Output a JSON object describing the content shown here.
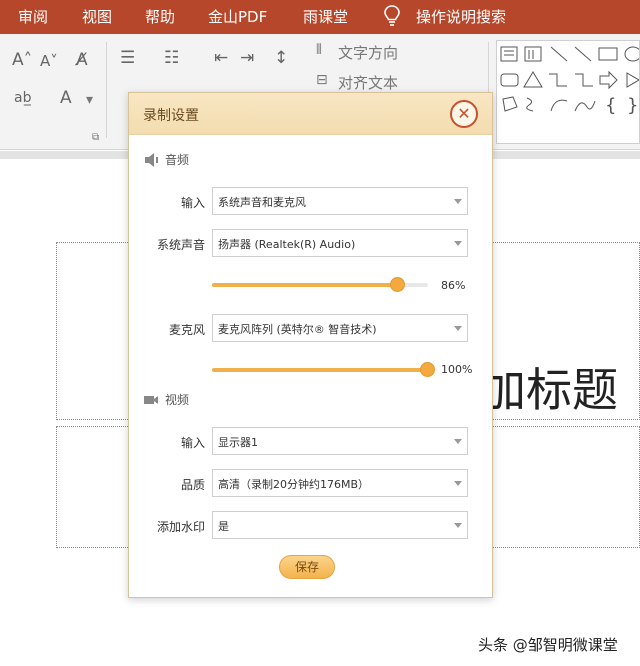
{
  "ribbon_tabs": [
    "审阅",
    "视图",
    "帮助",
    "金山PDF",
    "雨课堂",
    "操作说明搜索"
  ],
  "ribbon": {
    "text_direction": "文字方向",
    "align_text": "对齐文本"
  },
  "dialog": {
    "title": "录制设置",
    "audio_section": "音频",
    "video_section": "视频",
    "input_label": "输入",
    "input_value": "系统声音和麦克风",
    "system_sound_label": "系统声音",
    "system_sound_value": "扬声器 (Realtek(R) Audio)",
    "system_sound_percent": "86%",
    "system_sound_level": 0.86,
    "mic_label": "麦克风",
    "mic_value": "麦克风阵列 (英特尔® 智音技术)",
    "mic_percent": "100%",
    "mic_level": 1.0,
    "video_input_label": "输入",
    "video_input_value": "显示器1",
    "quality_label": "品质",
    "quality_value": "高清（录制20分钟约176MB）",
    "watermark_label": "添加水印",
    "watermark_value": "是",
    "save_label": "保存",
    "close_glyph": "✕"
  },
  "slide": {
    "title_fragment": "加标题"
  },
  "watermark_text": "头条 @邹智明微课堂",
  "colors": {
    "tabbar": "#b7472a",
    "accent": "#f3a93e"
  }
}
